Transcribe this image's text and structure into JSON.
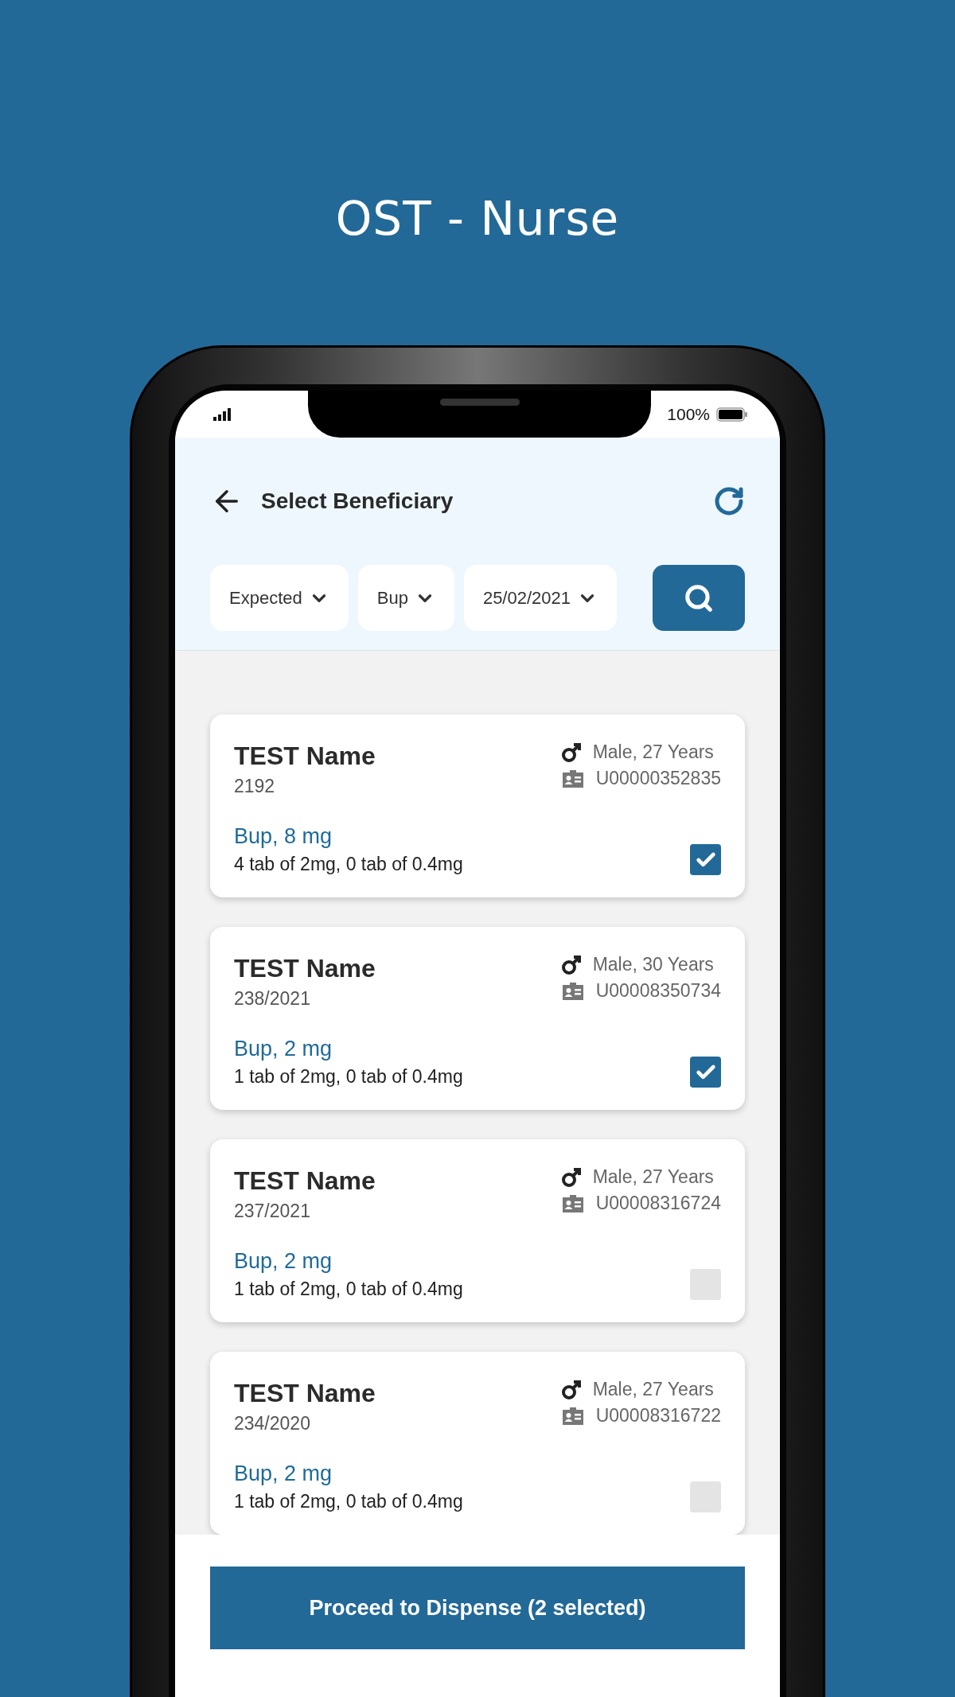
{
  "page_title": "OST - Nurse",
  "status_bar": {
    "battery": "100%"
  },
  "header": {
    "title": "Select Beneficiary"
  },
  "filters": [
    {
      "value": "Expected"
    },
    {
      "value": "Bup"
    },
    {
      "value": "25/02/2021"
    }
  ],
  "beneficiaries": [
    {
      "name": "TEST Name",
      "number": "2192",
      "gender_age": "Male, 27 Years",
      "uid": "U00000352835",
      "drug": "Bup, 8 mg",
      "dosage": "4 tab of 2mg, 0 tab of 0.4mg",
      "checked": true
    },
    {
      "name": "TEST Name",
      "number": "238/2021",
      "gender_age": "Male, 30 Years",
      "uid": "U00008350734",
      "drug": "Bup, 2 mg",
      "dosage": "1 tab of 2mg, 0 tab of 0.4mg",
      "checked": true
    },
    {
      "name": "TEST Name",
      "number": "237/2021",
      "gender_age": "Male, 27 Years",
      "uid": "U00008316724",
      "drug": "Bup, 2 mg",
      "dosage": "1 tab of 2mg, 0 tab of 0.4mg",
      "checked": false
    },
    {
      "name": "TEST Name",
      "number": "234/2020",
      "gender_age": "Male, 27 Years",
      "uid": "U00008316722",
      "drug": "Bup, 2 mg",
      "dosage": "1 tab of 2mg, 0 tab of 0.4mg",
      "checked": false
    }
  ],
  "proceed_button": "Proceed to Dispense (2 selected)"
}
